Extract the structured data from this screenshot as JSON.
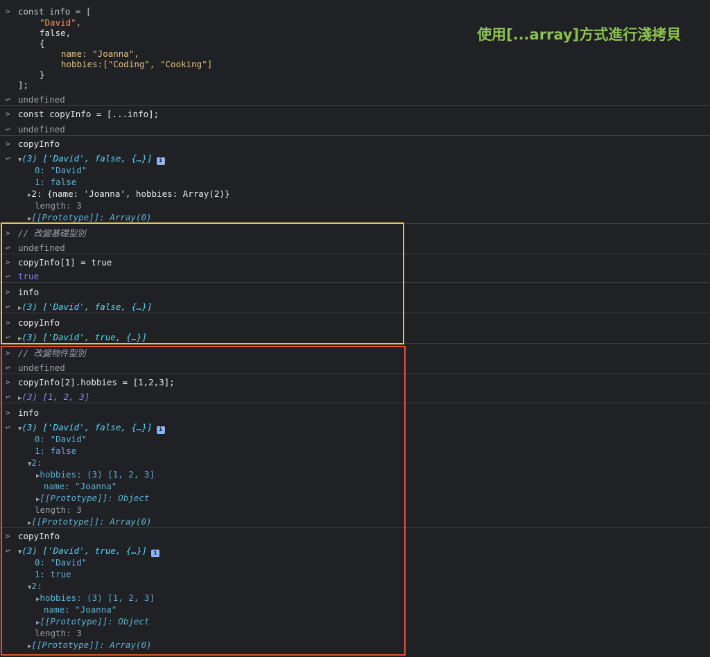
{
  "annotation": "使用[...array]方式進行淺拷貝",
  "colors": {
    "highlight_yellow": "#e6c64c",
    "highlight_red": "#e2552f",
    "annotation_green": "#8cc152"
  },
  "prompt_icons": {
    "input": "chevron-right-icon",
    "output": "return-arrow-icon"
  },
  "c": {
    "info_decl": "const info = [",
    "info_v1": "\"David\",",
    "info_v2": "false,",
    "info_v3": "{",
    "info_name": "name: \"Joanna\",",
    "info_hobbies": "hobbies:[\"Coding\", \"Cooking\"]",
    "info_close_obj": "}",
    "info_close": "];",
    "undefined": "undefined",
    "copy_decl": "const copyInfo = [...info];",
    "copyInfo": "copyInfo",
    "info": "info",
    "arr_david_false": "(3) ['David', false, {…}]",
    "arr_david_true": "(3) ['David', true, {…}]",
    "prop0": "0: \"David\"",
    "prop1_false": "1: false",
    "prop1_true": "1: true",
    "prop2_collapsed": "2: {name: 'Joanna', hobbies: Array(2)}",
    "length": "length: 3",
    "proto_array": "[[Prototype]]: Array(0)",
    "comment_basic": "// 改變基礎型別",
    "assign_bool": "copyInfo[1] = true",
    "true": "true",
    "comment_object": "// 改變物件型別",
    "assign_hobbies": "copyInfo[2].hobbies = [1,2,3];",
    "arr_123": "(3) [1, 2, 3]",
    "prop2_label": "2:",
    "hobbies_expanded": "hobbies: (3) [1, 2, 3]",
    "name_joanna": "name: \"Joanna\"",
    "proto_object": "[[Prototype]]: Object"
  }
}
